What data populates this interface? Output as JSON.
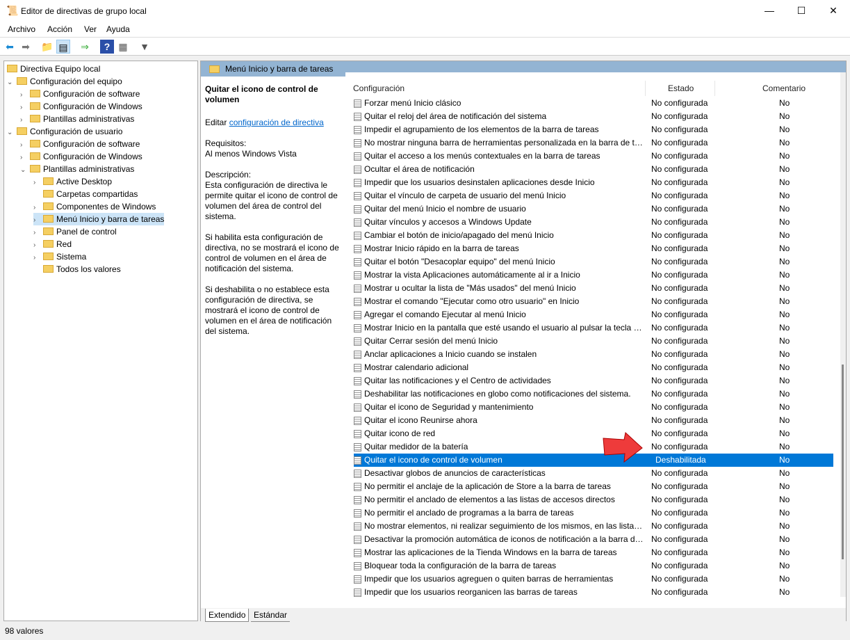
{
  "window": {
    "title": "Editor de directivas de grupo local",
    "min": "—",
    "max": "☐",
    "close": "✕"
  },
  "menu": [
    "Archivo",
    "Acción",
    "Ver",
    "Ayuda"
  ],
  "tree": [
    {
      "label": "Directiva Equipo local",
      "level": 0,
      "chev": ""
    },
    {
      "label": "Configuración del equipo",
      "level": 0,
      "chev": "v"
    },
    {
      "label": "Configuración de software",
      "level": 1,
      "chev": ">"
    },
    {
      "label": "Configuración de Windows",
      "level": 1,
      "chev": ">"
    },
    {
      "label": "Plantillas administrativas",
      "level": 1,
      "chev": ">"
    },
    {
      "label": "Configuración de usuario",
      "level": 0,
      "chev": "v"
    },
    {
      "label": "Configuración de software",
      "level": 1,
      "chev": ">"
    },
    {
      "label": "Configuración de Windows",
      "level": 1,
      "chev": ">"
    },
    {
      "label": "Plantillas administrativas",
      "level": 1,
      "chev": "v"
    },
    {
      "label": "Active Desktop",
      "level": 2,
      "chev": ">"
    },
    {
      "label": "Carpetas compartidas",
      "level": 2,
      "chev": ""
    },
    {
      "label": "Componentes de Windows",
      "level": 2,
      "chev": ">"
    },
    {
      "label": "Menú Inicio y barra de tareas",
      "level": 2,
      "chev": ">",
      "selected": true
    },
    {
      "label": "Panel de control",
      "level": 2,
      "chev": ">"
    },
    {
      "label": "Red",
      "level": 2,
      "chev": ">"
    },
    {
      "label": "Sistema",
      "level": 2,
      "chev": ">"
    },
    {
      "label": "Todos los valores",
      "level": 2,
      "chev": ""
    }
  ],
  "panel": {
    "header": "Menú Inicio y barra de tareas"
  },
  "desc": {
    "title": "Quitar el icono de control de volumen",
    "edit_prefix": "Editar ",
    "edit_link": "configuración de directiva",
    "req_label": "Requisitos:",
    "req": "Al menos Windows Vista",
    "desc_label": "Descripción:",
    "p1": "Esta configuración de directiva le permite quitar el icono de control de volumen del área de control del sistema.",
    "p2": "Si habilita esta configuración de directiva, no se mostrará el icono de control de volumen en el área de notificación del sistema.",
    "p3": "Si deshabilita o no establece esta configuración de directiva, se mostrará el icono de control de volumen en el área de notificación del sistema."
  },
  "columns": {
    "name": "Configuración",
    "state": "Estado",
    "comment": "Comentario"
  },
  "rows": [
    [
      "Forzar menú Inicio clásico",
      "No configurada",
      "No"
    ],
    [
      "Quitar el reloj del área de notificación del sistema",
      "No configurada",
      "No"
    ],
    [
      "Impedir el agrupamiento de los elementos de la barra de tareas",
      "No configurada",
      "No"
    ],
    [
      "No mostrar ninguna barra de herramientas personalizada en la barra de tareas",
      "No configurada",
      "No"
    ],
    [
      "Quitar el acceso a los menús contextuales en la barra de tareas",
      "No configurada",
      "No"
    ],
    [
      "Ocultar el área de notificación",
      "No configurada",
      "No"
    ],
    [
      "Impedir que los usuarios desinstalen aplicaciones desde Inicio",
      "No configurada",
      "No"
    ],
    [
      "Quitar el vínculo de carpeta de usuario del menú Inicio",
      "No configurada",
      "No"
    ],
    [
      "Quitar del menú Inicio el nombre de usuario",
      "No configurada",
      "No"
    ],
    [
      "Quitar vínculos y accesos a Windows Update",
      "No configurada",
      "No"
    ],
    [
      "Cambiar el botón de inicio/apagado del menú Inicio",
      "No configurada",
      "No"
    ],
    [
      "Mostrar Inicio rápido en la barra de tareas",
      "No configurada",
      "No"
    ],
    [
      "Quitar el botón \"Desacoplar equipo\" del menú Inicio",
      "No configurada",
      "No"
    ],
    [
      "Mostrar la vista Aplicaciones automáticamente al ir a Inicio",
      "No configurada",
      "No"
    ],
    [
      "Mostrar u ocultar la lista de \"Más usados\" del menú Inicio",
      "No configurada",
      "No"
    ],
    [
      "Mostrar el comando \"Ejecutar como otro usuario\" en Inicio",
      "No configurada",
      "No"
    ],
    [
      "Agregar el comando Ejecutar al menú Inicio",
      "No configurada",
      "No"
    ],
    [
      "Mostrar Inicio en la pantalla que esté usando el usuario al pulsar la tecla de Windows",
      "No configurada",
      "No"
    ],
    [
      "Quitar Cerrar sesión del menú Inicio",
      "No configurada",
      "No"
    ],
    [
      "Anclar aplicaciones a Inicio cuando se instalen",
      "No configurada",
      "No"
    ],
    [
      "Mostrar calendario adicional",
      "No configurada",
      "No"
    ],
    [
      "Quitar las notificaciones y el Centro de actividades",
      "No configurada",
      "No"
    ],
    [
      "Deshabilitar las notificaciones en globo como notificaciones del sistema.",
      "No configurada",
      "No"
    ],
    [
      "Quitar el icono de Seguridad y mantenimiento",
      "No configurada",
      "No"
    ],
    [
      "Quitar el icono Reunirse ahora",
      "No configurada",
      "No"
    ],
    [
      "Quitar icono de red",
      "No configurada",
      "No"
    ],
    [
      "Quitar medidor de la batería",
      "No configurada",
      "No"
    ],
    [
      "Quitar el icono de control de volumen",
      "Deshabilitada",
      "No"
    ],
    [
      "Desactivar globos de anuncios de características",
      "No configurada",
      "No"
    ],
    [
      "No permitir el anclaje de la aplicación de Store a la barra de tareas",
      "No configurada",
      "No"
    ],
    [
      "No permitir el anclado de elementos a las listas de accesos directos",
      "No configurada",
      "No"
    ],
    [
      "No permitir el anclado de programas a la barra de tareas",
      "No configurada",
      "No"
    ],
    [
      "No mostrar elementos, ni realizar seguimiento de los mismos, en las listas de accesos directos",
      "No configurada",
      "No"
    ],
    [
      "Desactivar la promoción automática de iconos de notificación a la barra de tareas",
      "No configurada",
      "No"
    ],
    [
      "Mostrar las aplicaciones de la Tienda Windows en la barra de tareas",
      "No configurada",
      "No"
    ],
    [
      "Bloquear toda la configuración de la barra de tareas",
      "No configurada",
      "No"
    ],
    [
      "Impedir que los usuarios agreguen o quiten barras de herramientas",
      "No configurada",
      "No"
    ],
    [
      "Impedir que los usuarios reorganicen las barras de tareas",
      "No configurada",
      "No"
    ]
  ],
  "selected_row": 27,
  "tabs": [
    "Extendido",
    "Estándar"
  ],
  "status": "98 valores"
}
